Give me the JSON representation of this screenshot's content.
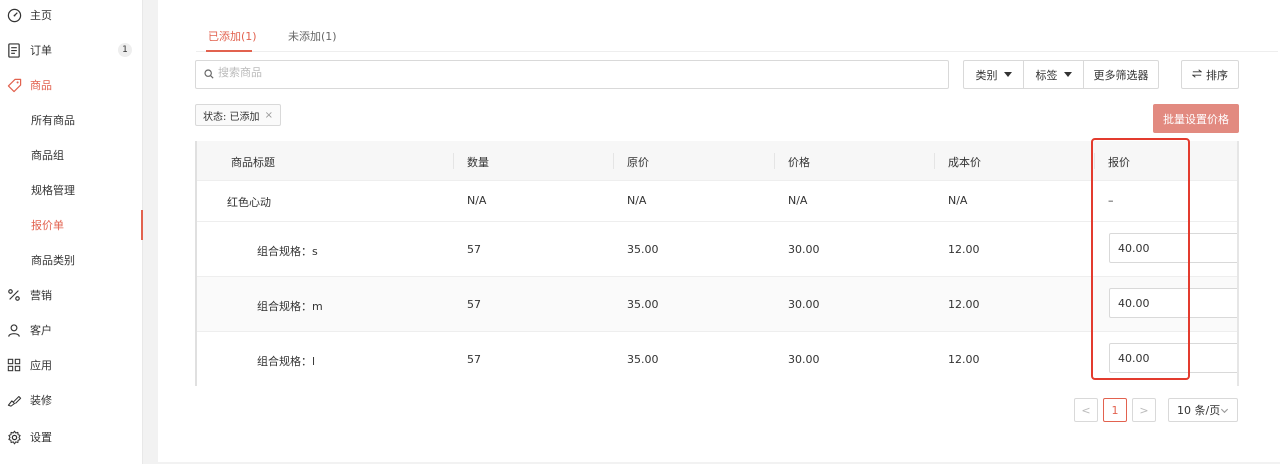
{
  "sidebar": {
    "items": [
      {
        "label": "主页"
      },
      {
        "label": "订单",
        "badge": "1"
      },
      {
        "label": "商品"
      },
      {
        "label": "所有商品"
      },
      {
        "label": "商品组"
      },
      {
        "label": "规格管理"
      },
      {
        "label": "报价单"
      },
      {
        "label": "商品类别"
      },
      {
        "label": "营销"
      },
      {
        "label": "客户"
      },
      {
        "label": "应用"
      },
      {
        "label": "装修"
      },
      {
        "label": "设置"
      }
    ]
  },
  "tabs": {
    "added": "已添加(1)",
    "not_added": "未添加(1)"
  },
  "search": {
    "placeholder": "搜索商品"
  },
  "filters": {
    "category": "类别",
    "tags": "标签",
    "more": "更多筛选器",
    "sort": "排序"
  },
  "active_filter": {
    "label": "状态: 已添加",
    "remove": "×"
  },
  "batch_button": "批量设置价格",
  "table": {
    "headers": [
      "商品标题",
      "数量",
      "原价",
      "价格",
      "成本价",
      "报价"
    ],
    "rows": [
      {
        "title": "红色心动",
        "qty": "N/A",
        "original": "N/A",
        "price": "N/A",
        "cost": "N/A",
        "quote": "–"
      },
      {
        "title": "组合规格：s",
        "qty": "57",
        "original": "35.00",
        "price": "30.00",
        "cost": "12.00",
        "quote": "40.00"
      },
      {
        "title": "组合规格：m",
        "qty": "57",
        "original": "35.00",
        "price": "30.00",
        "cost": "12.00",
        "quote": "40.00"
      },
      {
        "title": "组合规格：l",
        "qty": "57",
        "original": "35.00",
        "price": "30.00",
        "cost": "12.00",
        "quote": "40.00"
      }
    ]
  },
  "pagination": {
    "prev": "<",
    "page": "1",
    "next": ">",
    "page_size": "10 条/页"
  },
  "colors": {
    "accent": "#e2624f",
    "highlight": "#e33b2e",
    "batch_button": "#e28a80"
  }
}
